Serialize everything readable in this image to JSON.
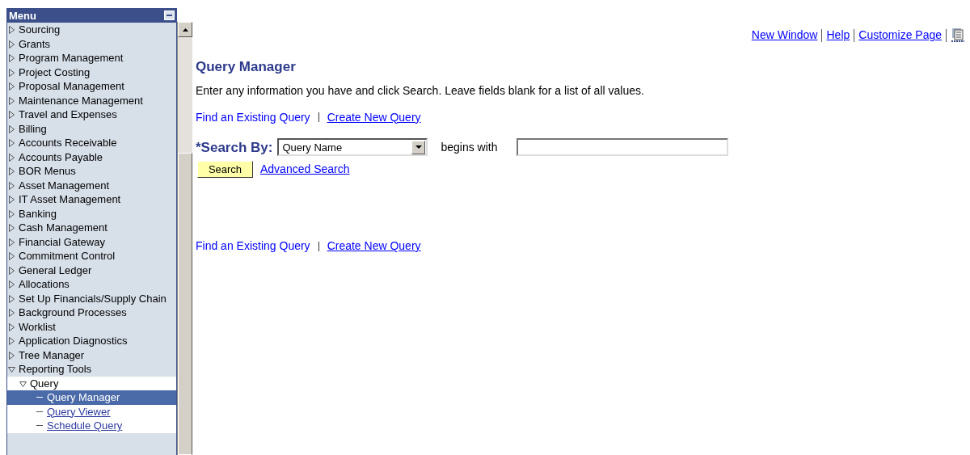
{
  "menu": {
    "title": "Menu",
    "items": [
      {
        "label": "Sourcing",
        "expanded": false
      },
      {
        "label": "Grants",
        "expanded": false
      },
      {
        "label": "Program Management",
        "expanded": false
      },
      {
        "label": "Project Costing",
        "expanded": false
      },
      {
        "label": "Proposal Management",
        "expanded": false
      },
      {
        "label": "Maintenance Management",
        "expanded": false
      },
      {
        "label": "Travel and Expenses",
        "expanded": false
      },
      {
        "label": "Billing",
        "expanded": false
      },
      {
        "label": "Accounts Receivable",
        "expanded": false
      },
      {
        "label": "Accounts Payable",
        "expanded": false
      },
      {
        "label": "BOR Menus",
        "expanded": false
      },
      {
        "label": "Asset Management",
        "expanded": false
      },
      {
        "label": "IT Asset Management",
        "expanded": false
      },
      {
        "label": "Banking",
        "expanded": false
      },
      {
        "label": "Cash Management",
        "expanded": false
      },
      {
        "label": "Financial Gateway",
        "expanded": false
      },
      {
        "label": "Commitment Control",
        "expanded": false
      },
      {
        "label": "General Ledger",
        "expanded": false
      },
      {
        "label": "Allocations",
        "expanded": false
      },
      {
        "label": "Set Up Financials/Supply Chain",
        "expanded": false
      },
      {
        "label": "Background Processes",
        "expanded": false
      },
      {
        "label": "Worklist",
        "expanded": false
      },
      {
        "label": "Application Diagnostics",
        "expanded": false
      },
      {
        "label": "Tree Manager",
        "expanded": false
      },
      {
        "label": "Reporting Tools",
        "expanded": true,
        "children": [
          {
            "label": "Query",
            "expanded": true,
            "children": [
              {
                "label": "Query Manager",
                "selected": true
              },
              {
                "label": "Query Viewer",
                "selected": false
              },
              {
                "label": "Schedule Query",
                "selected": false
              }
            ]
          }
        ]
      }
    ]
  },
  "header_links": [
    "New Window",
    "Help",
    "Customize Page"
  ],
  "page": {
    "title": "Query Manager",
    "instructions": "Enter any information you have and click Search. Leave fields blank for a list of all values.",
    "tabs": [
      {
        "label": "Find an Existing Query",
        "selected": true
      },
      {
        "label": "Create New Query",
        "selected": false
      }
    ],
    "search_by_label": "*Search By:",
    "search_by_value": "Query Name",
    "operator": "begins with",
    "search_button": "Search",
    "advanced_link": "Advanced Search",
    "bottom_tabs": [
      {
        "label": "Find an Existing Query",
        "selected": true
      },
      {
        "label": "Create New Query",
        "selected": false
      }
    ]
  }
}
